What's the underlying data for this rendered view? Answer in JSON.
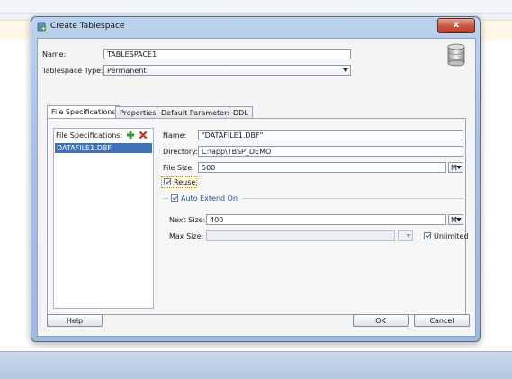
{
  "dialog": {
    "title": "Create Tablespace",
    "close_label": "x"
  },
  "form": {
    "name_label": "Name:",
    "name_value": "TABLESPACE1",
    "type_label": "Tablespace Type:",
    "type_value": "Permanent"
  },
  "tabs": [
    {
      "label": "File Specifications",
      "active": true
    },
    {
      "label": "Properties",
      "active": false
    },
    {
      "label": "Default Parameters",
      "active": false
    },
    {
      "label": "DDL",
      "active": false
    }
  ],
  "file_specs": {
    "list_label": "File Specifications:",
    "items": [
      "DATAFILE1.DBF"
    ],
    "name_label": "Name:",
    "name_value": "\"DATAFILE1.DBF\"",
    "directory_label": "Directory:",
    "directory_value": "C:\\app\\TBSP_DEMO",
    "filesize_label": "File Size:",
    "filesize_value": "500",
    "filesize_unit": "M",
    "reuse_label": "Reuse",
    "reuse_checked": true,
    "autoextend_label": "Auto Extend On",
    "autoextend_checked": true,
    "nextsize_label": "Next Size:",
    "nextsize_value": "400",
    "nextsize_unit": "M",
    "maxsize_label": "Max Size:",
    "maxsize_value": "",
    "unlimited_label": "Unlimited",
    "unlimited_checked": true
  },
  "buttons": {
    "help": "Help",
    "ok": "OK",
    "cancel": "Cancel"
  },
  "colors": {
    "selection": "#3d72b8",
    "add_icon": "#2e9b2e",
    "delete_icon": "#d42a1a"
  }
}
